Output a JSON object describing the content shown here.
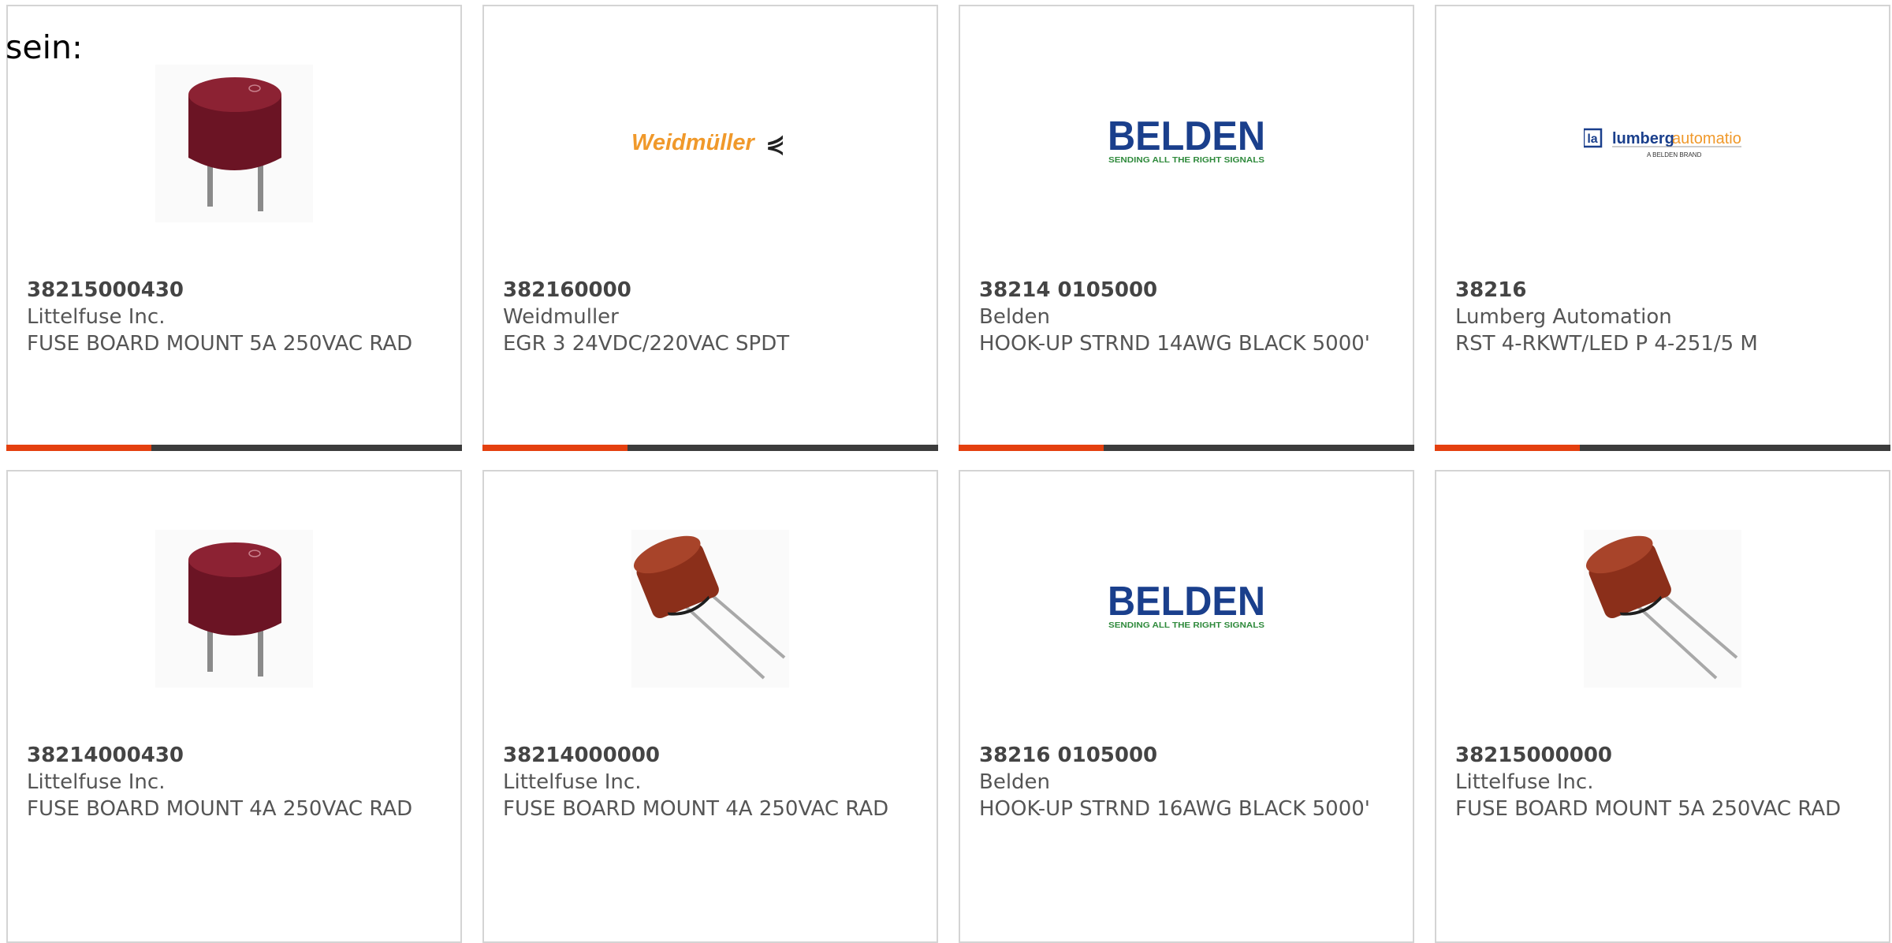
{
  "intro_text": "sein:",
  "colors": {
    "accent": "#e4400f",
    "bar": "#3c3c3c",
    "border": "#d4d4d4",
    "text": "#555555"
  },
  "products": [
    {
      "part": "38215000430",
      "maker": "Littelfuse Inc.",
      "desc": "FUSE BOARD MOUNT 5A 250VAC RAD",
      "image": "fuse-red-radial-image"
    },
    {
      "part": "382160000",
      "maker": "Weidmuller",
      "desc": "EGR 3 24VDC/220VAC SPDT",
      "image": "weidmuller-logo",
      "logo_text": "Weidmüller"
    },
    {
      "part": "38214 0105000",
      "maker": "Belden",
      "desc": "HOOK-UP STRND 14AWG BLACK 5000'",
      "image": "belden-logo",
      "logo_text": "BELDEN",
      "logo_tagline": "SENDING ALL THE RIGHT SIGNALS"
    },
    {
      "part": "38216",
      "maker": "Lumberg Automation",
      "desc": "RST 4-RKWT/LED P 4-251/5 M",
      "image": "lumberg-logo",
      "logo_text": "lumberg",
      "logo_text2": "automation",
      "logo_tagline": "A BELDEN BRAND"
    },
    {
      "part": "38214000430",
      "maker": "Littelfuse Inc.",
      "desc": "FUSE BOARD MOUNT 4A 250VAC RAD",
      "image": "fuse-red-radial-image"
    },
    {
      "part": "38214000000",
      "maker": "Littelfuse Inc.",
      "desc": "FUSE BOARD MOUNT 4A 250VAC RAD",
      "image": "fuse-brown-angled-image"
    },
    {
      "part": "38216 0105000",
      "maker": "Belden",
      "desc": "HOOK-UP STRND 16AWG BLACK 5000'",
      "image": "belden-logo",
      "logo_text": "BELDEN",
      "logo_tagline": "SENDING ALL THE RIGHT SIGNALS"
    },
    {
      "part": "38215000000",
      "maker": "Littelfuse Inc.",
      "desc": "FUSE BOARD MOUNT 5A 250VAC RAD",
      "image": "fuse-brown-angled-image"
    }
  ]
}
